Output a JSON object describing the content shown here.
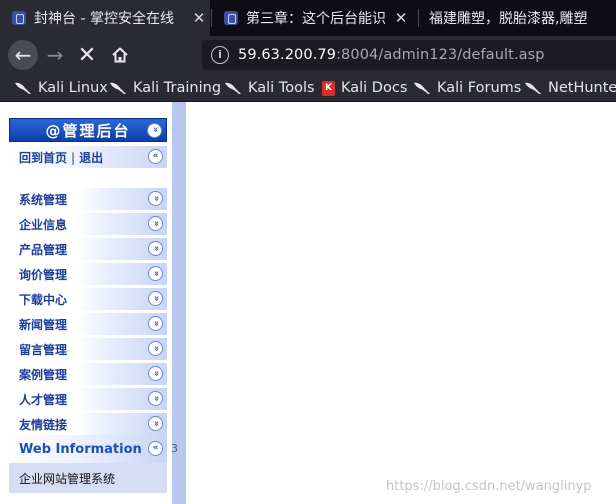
{
  "tabs": [
    {
      "title": "封神台 - 掌控安全在线",
      "active": true,
      "close": "✕"
    },
    {
      "title": "第三章：这个后台能识",
      "active": false,
      "close": "✕"
    },
    {
      "title": "福建雕塑，脱胎漆器,雕塑",
      "active": false,
      "close": ""
    }
  ],
  "nav": {
    "back_icon": "←",
    "forward_icon": "→",
    "stop_icon": "✕",
    "home_icon": "⌂",
    "url_host": "59.63.200.79",
    "url_rest": ":8004/admin123/default.asp",
    "info_icon": "i"
  },
  "bookmarks": [
    {
      "label": "Kali Linux",
      "icon": "kali-dragon-icon"
    },
    {
      "label": "Kali Training",
      "icon": "kali-dragon-icon"
    },
    {
      "label": "Kali Tools",
      "icon": "kali-dragon-icon"
    },
    {
      "label": "Kali Docs",
      "icon": "kali-docs-icon"
    },
    {
      "label": "Kali Forums",
      "icon": "kali-dragon-icon"
    },
    {
      "label": "NetHunter",
      "icon": "kali-dragon-icon"
    }
  ],
  "sidebar": {
    "header_title": "@管理后台",
    "header_icon": "»",
    "sub_links": {
      "home": "回到首页",
      "sep": "|",
      "logout": "退出",
      "icon": "«"
    },
    "items": [
      {
        "label": "系统管理",
        "icon": "»"
      },
      {
        "label": "企业信息",
        "icon": "»"
      },
      {
        "label": "产品管理",
        "icon": "»"
      },
      {
        "label": "询价管理",
        "icon": "»"
      },
      {
        "label": "下载中心",
        "icon": "»"
      },
      {
        "label": "新闻管理",
        "icon": "»"
      },
      {
        "label": "留言管理",
        "icon": "»"
      },
      {
        "label": "案例管理",
        "icon": "»"
      },
      {
        "label": "人才管理",
        "icon": "»"
      },
      {
        "label": "友情链接",
        "icon": "»"
      }
    ],
    "web_info": {
      "label": "Web Information",
      "icon": "«"
    },
    "stray_char": "3",
    "system_name": "企业网站管理系统"
  },
  "watermark": "https://blog.csdn.net/wanglinyp",
  "colors": {
    "chrome_bg": "#2a2a33",
    "tabstrip_bg": "#0d0d13",
    "menu_header": "#1446b8",
    "menu_text": "#1d3f9a",
    "frame_strip": "#b8c7ec"
  }
}
